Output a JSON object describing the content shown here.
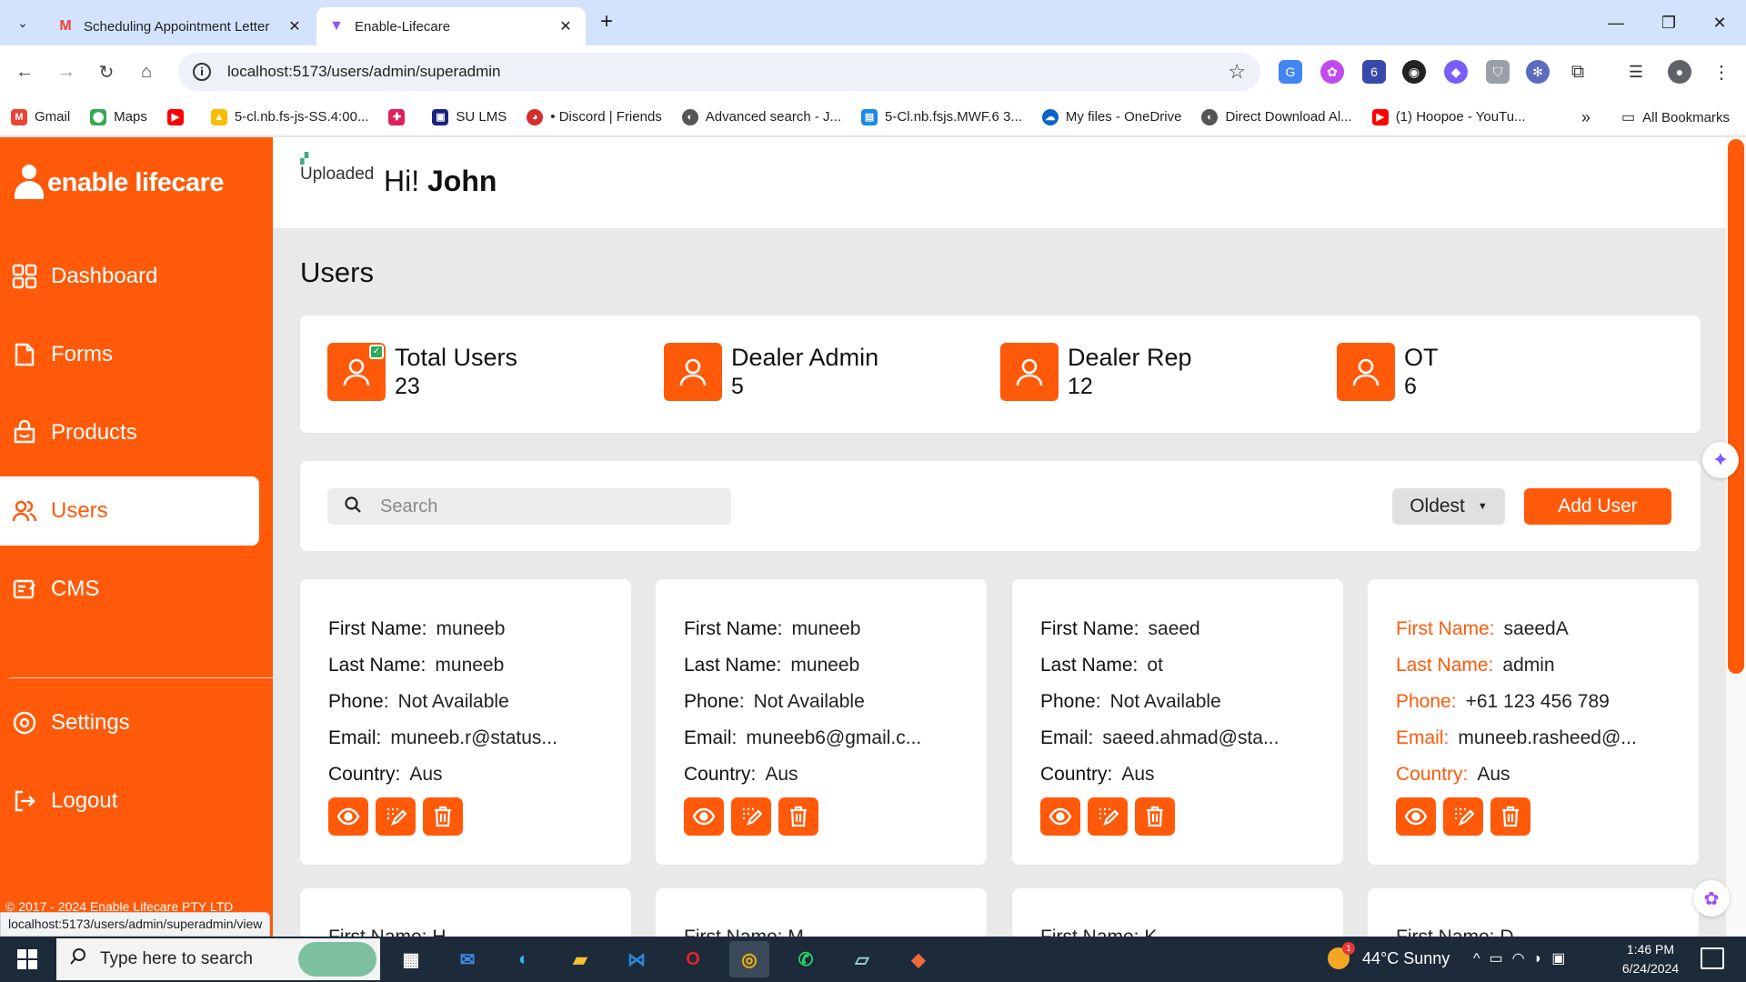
{
  "browser": {
    "tabs": [
      {
        "title": "Scheduling Appointment Letter",
        "favicon": "gmail-icon"
      },
      {
        "title": "Enable-Lifecare",
        "favicon": "vite-icon"
      }
    ],
    "url": "localhost:5173/users/admin/superadmin",
    "bookmarks": [
      {
        "label": "Gmail",
        "icon": "gmail-icon",
        "color": "#ea4335"
      },
      {
        "label": "Maps",
        "icon": "maps-icon",
        "color": "#34a853"
      },
      {
        "label": "",
        "icon": "youtube-icon",
        "color": "#ff0000"
      },
      {
        "label": "5-cl.nb.fs-js-SS.4:00...",
        "icon": "drive-icon",
        "color": "#fbbc04"
      },
      {
        "label": "",
        "icon": "slack-icon",
        "color": "#e01e5a"
      },
      {
        "label": "SU LMS",
        "icon": "lms-icon",
        "color": "#1a237e"
      },
      {
        "label": "• Discord | Friends",
        "icon": "discord-icon",
        "color": "#d32f2f"
      },
      {
        "label": "Advanced search - J...",
        "icon": "globe-icon",
        "color": "#555555"
      },
      {
        "label": "5-Cl.nb.fsjs.MWF.6 3...",
        "icon": "classroom-icon",
        "color": "#1e88e5"
      },
      {
        "label": "My files - OneDrive",
        "icon": "onedrive-icon",
        "color": "#0a64c8"
      },
      {
        "label": "Direct Download Al...",
        "icon": "globe-icon",
        "color": "#555555"
      },
      {
        "label": "(1) Hoopoe - YouTu...",
        "icon": "youtube-icon",
        "color": "#ff0000"
      }
    ],
    "all_bookmarks": "All Bookmarks",
    "status_url": "localhost:5173/users/admin/superadmin/view"
  },
  "app": {
    "brand": "enable lifecare",
    "nav": [
      {
        "label": "Dashboard",
        "icon": "dashboard-icon"
      },
      {
        "label": "Forms",
        "icon": "forms-icon"
      },
      {
        "label": "Products",
        "icon": "products-icon"
      },
      {
        "label": "Users",
        "icon": "users-icon",
        "active": true
      },
      {
        "label": "CMS",
        "icon": "cms-icon"
      }
    ],
    "nav_bottom": [
      {
        "label": "Settings",
        "icon": "settings-icon"
      },
      {
        "label": "Logout",
        "icon": "logout-icon"
      }
    ],
    "copyright": "© 2017 - 2024 Enable Lifecare PTY LTD",
    "avatar_alt": "Uploaded",
    "greeting_prefix": "Hi!",
    "greeting_name": "John",
    "page_title": "Users",
    "stats": [
      {
        "label": "Total Users",
        "value": "23"
      },
      {
        "label": "Dealer Admin",
        "value": "5"
      },
      {
        "label": "Dealer Rep",
        "value": "12"
      },
      {
        "label": "OT",
        "value": "6"
      }
    ],
    "search_placeholder": "Search",
    "sort_label": "Oldest",
    "add_user_label": "Add User",
    "field_labels": {
      "first_name": "First Name:",
      "last_name": "Last Name:",
      "phone": "Phone:",
      "email": "Email:",
      "country": "Country:"
    },
    "users": [
      {
        "first_name": "muneeb",
        "last_name": "muneeb",
        "phone": "Not Available",
        "email": "muneeb.r@status...",
        "country": "Aus"
      },
      {
        "first_name": "muneeb",
        "last_name": "muneeb",
        "phone": "Not Available",
        "email": "muneeb6@gmail.c...",
        "country": "Aus"
      },
      {
        "first_name": "saeed",
        "last_name": "ot",
        "phone": "Not Available",
        "email": "saeed.ahmad@sta...",
        "country": "Aus"
      },
      {
        "first_name": "saeedA",
        "last_name": "admin",
        "phone": "+61 123 456 789",
        "email": "muneeb.rasheed@...",
        "country": "Aus",
        "highlighted": true
      }
    ],
    "users_partial": [
      {
        "peek": "First Name: H..."
      },
      {
        "peek": "First Name: M..."
      },
      {
        "peek": "First Name: K..."
      },
      {
        "peek": "First Name: D..."
      }
    ],
    "accent_color": "#ff5a0a"
  },
  "taskbar": {
    "search_placeholder": "Type here to search",
    "weather": "44°C  Sunny",
    "weather_badge": "1",
    "time": "1:46 PM",
    "date": "6/24/2024"
  }
}
